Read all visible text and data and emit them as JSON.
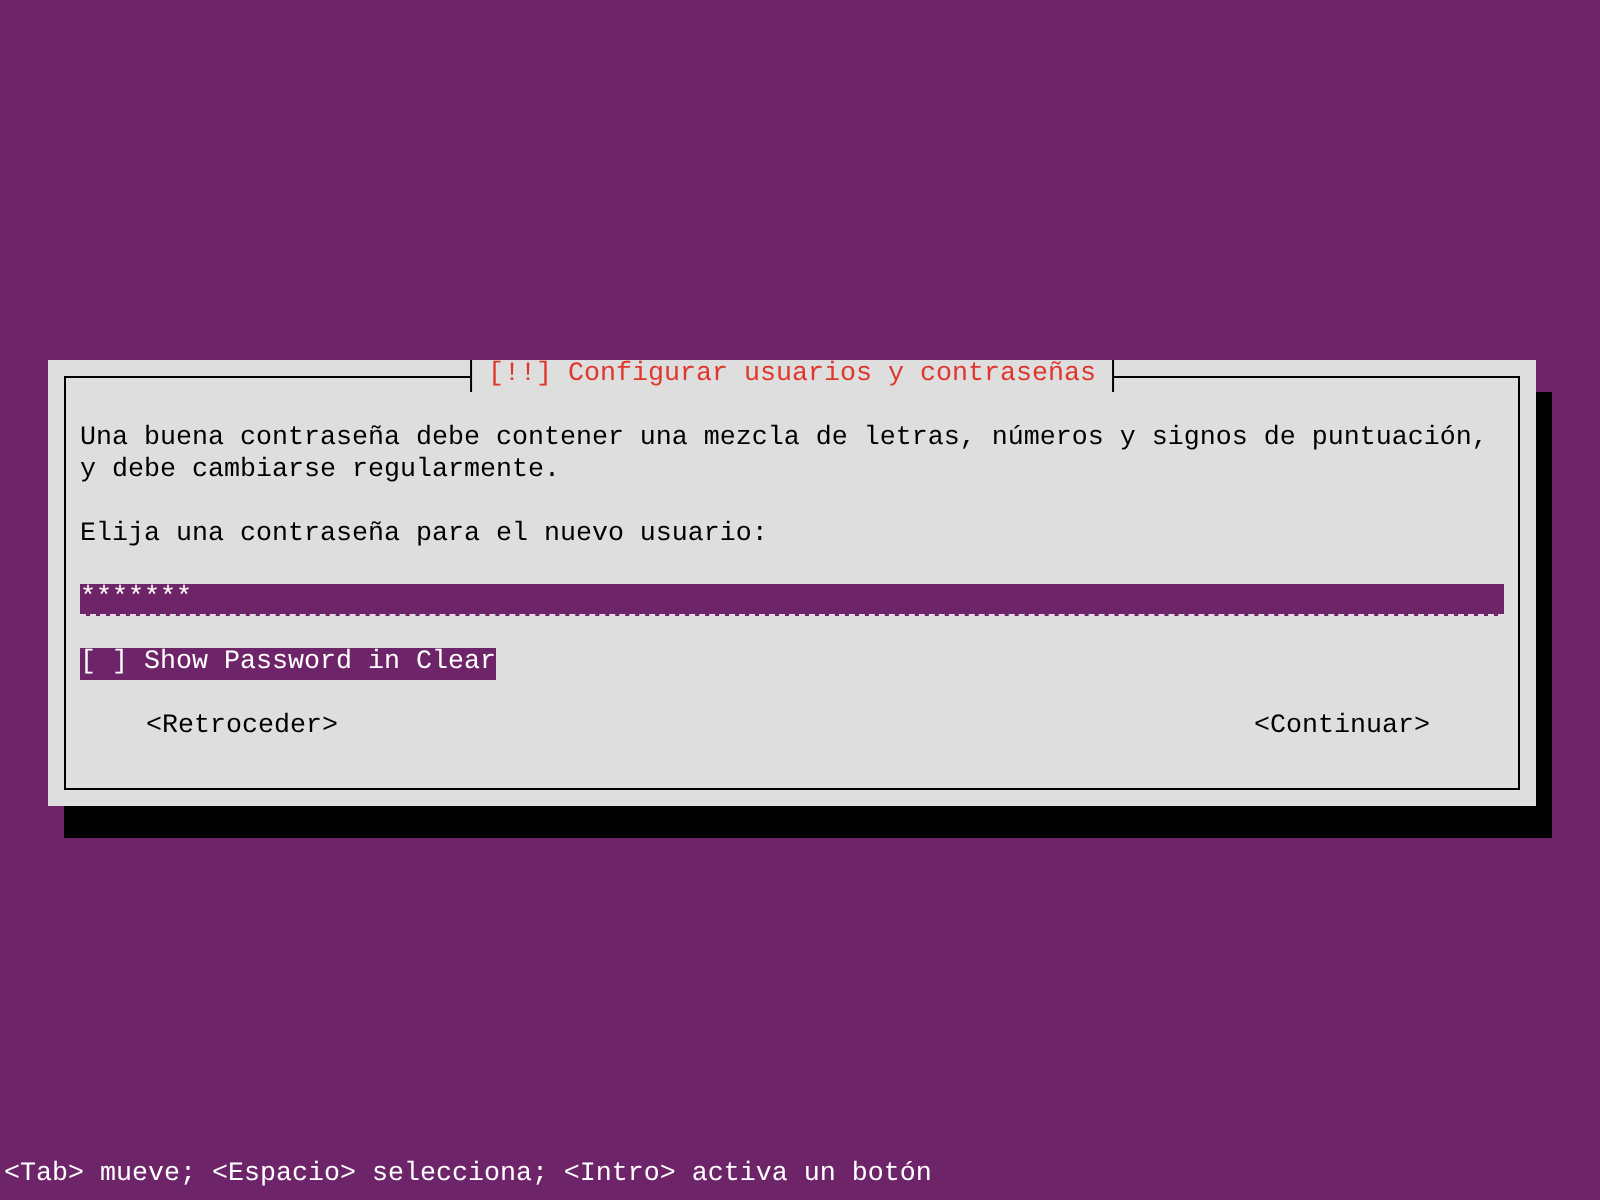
{
  "dialog": {
    "title": "[!!] Configurar usuarios y contraseñas",
    "paragraphs": [
      "Una buena contraseña debe contener una mezcla de letras, números y signos de puntuación,\ny debe cambiarse regularmente.",
      "Elija una contraseña para el nuevo usuario:"
    ],
    "password_field": {
      "value": "*******"
    },
    "checkbox": {
      "brackets": "[ ]",
      "label": "Show Password in Clear",
      "checked": false,
      "focused": true
    },
    "buttons": [
      {
        "label": "<Retroceder>",
        "selected": false
      },
      {
        "label": "<Continuar>",
        "selected": false
      }
    ]
  },
  "status_bar": "<Tab> mueve; <Espacio> selecciona; <Intro> activa un botón"
}
